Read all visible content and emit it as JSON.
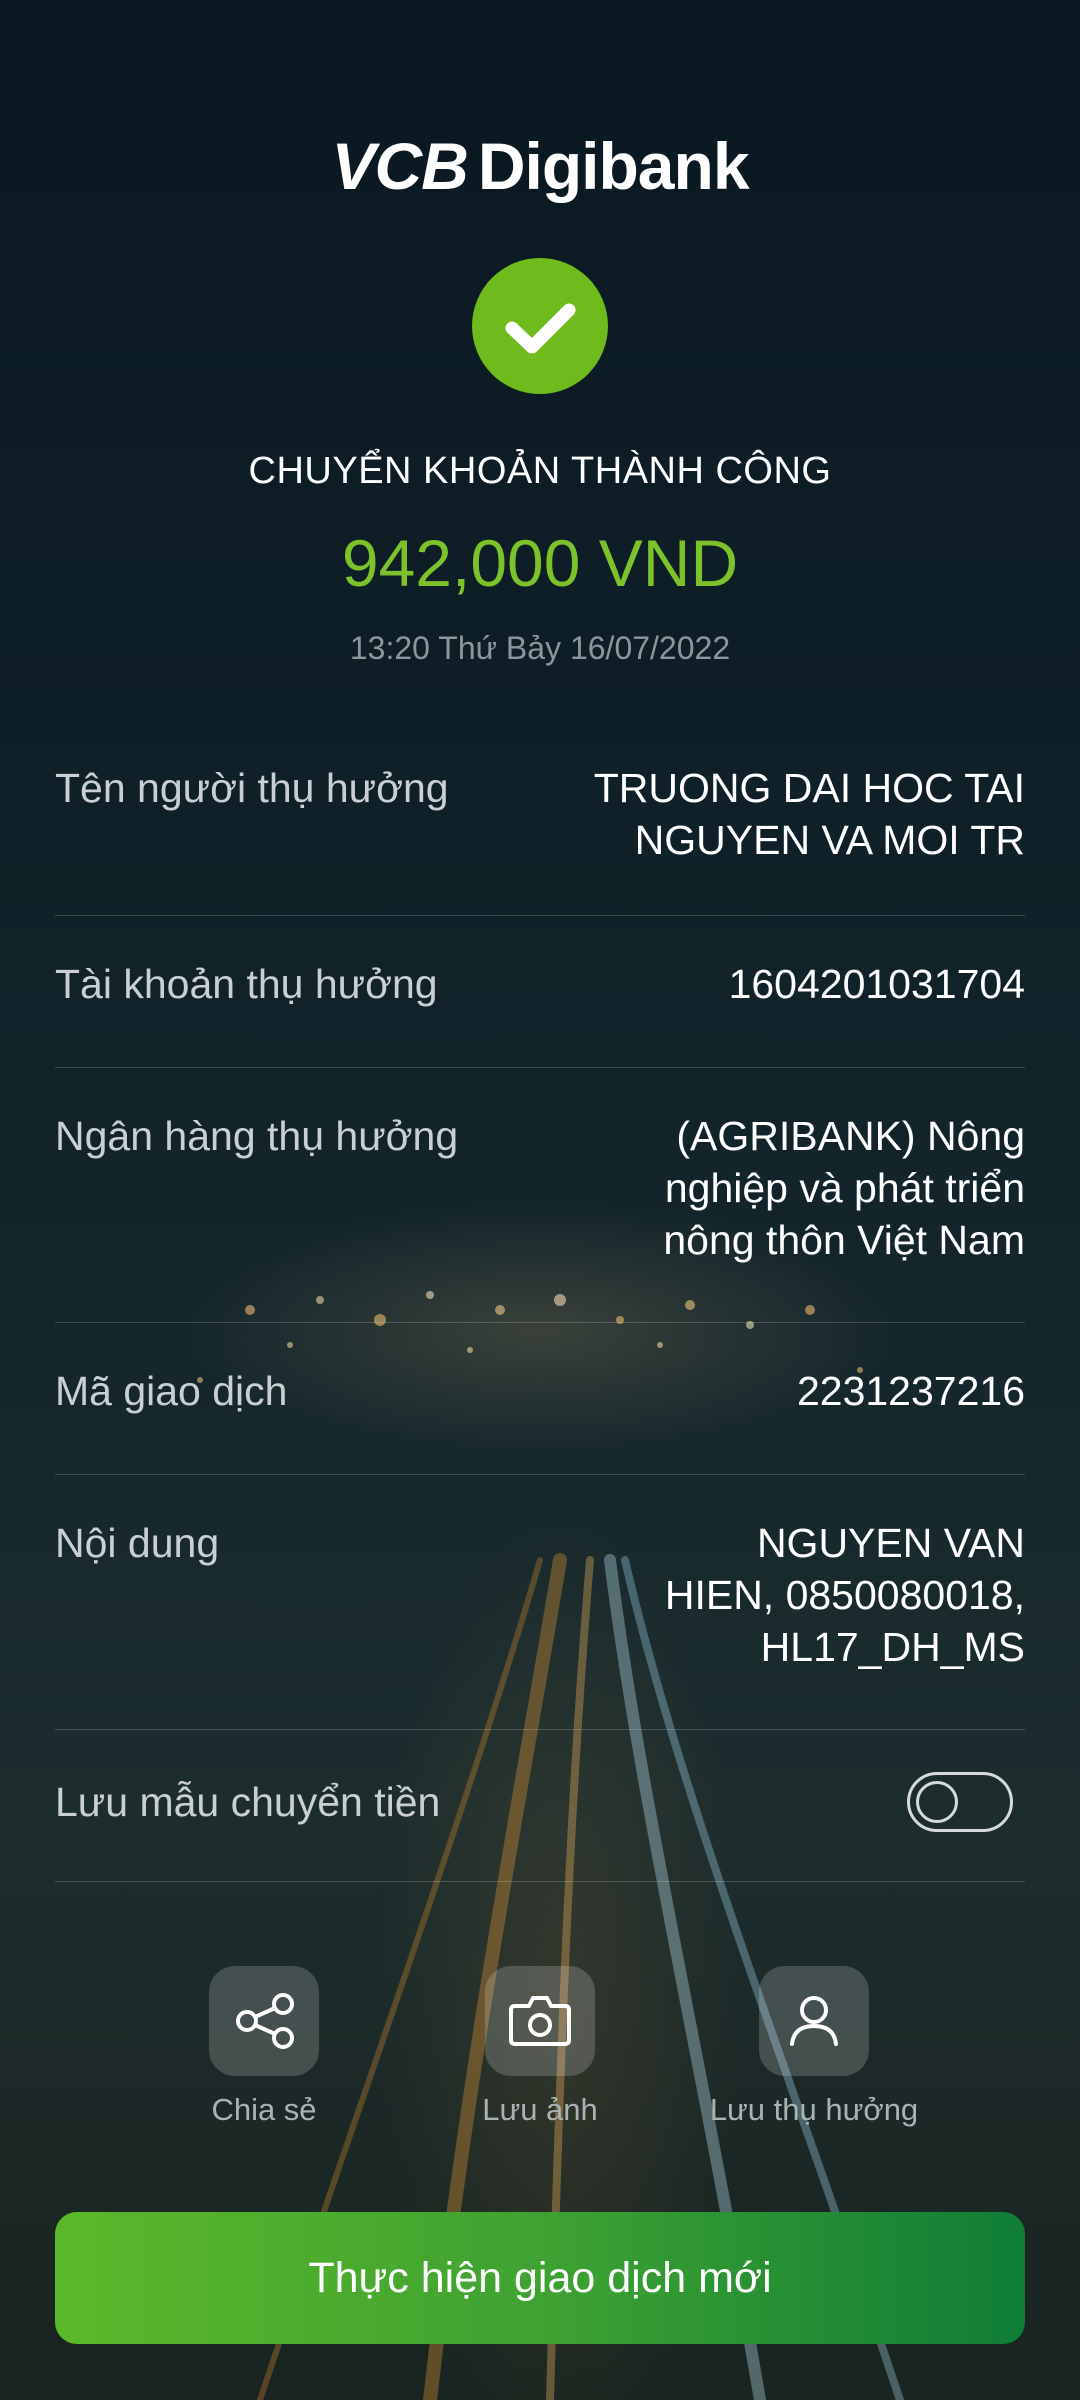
{
  "header": {
    "logo_vcb": "VCB",
    "logo_digibank": "Digibank"
  },
  "result": {
    "title": "CHUYỂN KHOẢN THÀNH CÔNG",
    "amount": "942,000 VND",
    "datetime": "13:20 Thứ Bảy 16/07/2022",
    "icon": "check-icon",
    "accent_color": "#6fba1c"
  },
  "details": {
    "beneficiary_name": {
      "label": "Tên người thụ hưởng",
      "value_line1": "TRUONG DAI HOC TAI",
      "value_line2": "NGUYEN VA MOI TR"
    },
    "beneficiary_account": {
      "label": "Tài khoản thụ hưởng",
      "value": "1604201031704"
    },
    "beneficiary_bank": {
      "label": "Ngân hàng thụ hưởng",
      "value_line1": "(AGRIBANK) Nông",
      "value_line2": "nghiệp và phát triển",
      "value_line3": "nông thôn Việt Nam"
    },
    "transaction_code": {
      "label": "Mã giao dịch",
      "value": "2231237216"
    },
    "content": {
      "label": "Nội dung",
      "value_line1": "NGUYEN VAN",
      "value_line2": "HIEN, 0850080018,",
      "value_line3": "HL17_DH_MS"
    },
    "save_template": {
      "label": "Lưu mẫu chuyển tiền",
      "enabled": false
    }
  },
  "actions": {
    "share": {
      "label": "Chia sẻ",
      "icon": "share-icon"
    },
    "save_image": {
      "label": "Lưu ảnh",
      "icon": "camera-icon"
    },
    "save_beneficiary": {
      "label": "Lưu thụ hưởng",
      "icon": "user-icon"
    }
  },
  "cta": {
    "label": "Thực hiện giao dịch mới"
  }
}
